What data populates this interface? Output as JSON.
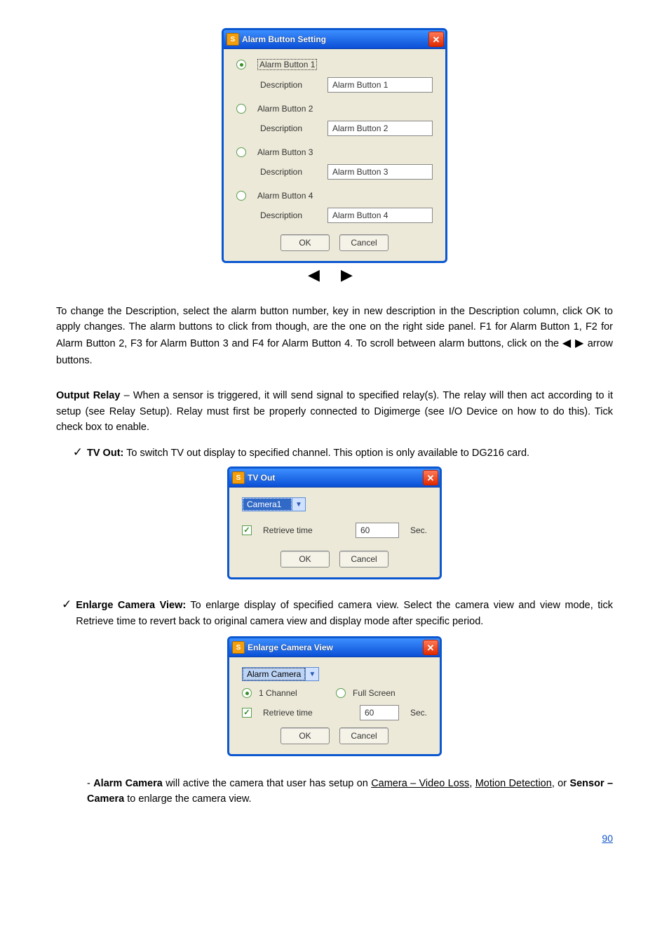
{
  "dialog1": {
    "title": "Alarm Button Setting",
    "buttons": [
      {
        "radio_label": "Alarm Button 1",
        "desc_label": "Description",
        "desc_value": "Alarm Button 1",
        "selected": true
      },
      {
        "radio_label": "Alarm Button 2",
        "desc_label": "Description",
        "desc_value": "Alarm Button 2",
        "selected": false
      },
      {
        "radio_label": "Alarm Button 3",
        "desc_label": "Description",
        "desc_value": "Alarm Button 3",
        "selected": false
      },
      {
        "radio_label": "Alarm Button 4",
        "desc_label": "Description",
        "desc_value": "Alarm Button 4",
        "selected": false
      }
    ],
    "ok": "OK",
    "cancel": "Cancel"
  },
  "para1": {
    "text": "To change the Description, select the alarm button number, key in new description in the Description column, click OK to apply changes. The alarm buttons to click from though, are the one on the right side panel. F1 for Alarm Button 1, F2 for Alarm Button 2, F3 for Alarm Button 3 and F4 for Alarm Button 4. To scroll between alarm buttons, click on the",
    "tail": " arrow buttons."
  },
  "para2": {
    "title": "Output Relay",
    "text": " – When a sensor is triggered, it will send signal to specified relay(s). The relay will then act according to it setup (see ",
    "linkish": "Relay Setup",
    "tail2": "). Relay must first be properly connected to Digimerge (see ",
    "linkish2": "I/O Device",
    "tail3": "on how to do this). Tick check box to enable."
  },
  "item_tvout": {
    "title": "TV Out:",
    "text": " To switch TV out display to specified channel. This option is only available to DG216 card."
  },
  "dialog2": {
    "title": "TV Out",
    "camera": "Camera1",
    "retrieve_label": "Retrieve time",
    "retrieve_checked": true,
    "retrieve_value": "60",
    "sec": "Sec.",
    "ok": "OK",
    "cancel": "Cancel"
  },
  "item_enlarge_intro": {
    "title": "Enlarge Camera View:",
    "text": " To enlarge display of specified camera view. Select the camera view and view mode, tick Retrieve time to revert back to original camera view and display mode after specific period."
  },
  "dialog3": {
    "title": "Enlarge Camera View",
    "camera": "Alarm Camera",
    "opt1": "1 Channel",
    "opt2": "Full Screen",
    "retrieve_label": "Retrieve time",
    "retrieve_checked": true,
    "retrieve_value": "60",
    "sec": "Sec.",
    "ok": "OK",
    "cancel": "Cancel"
  },
  "footer": {
    "text1": "- ",
    "bold1": "Alarm Camera",
    "text2": " will active the camera that user has setup on ",
    "underline": "Camera – Video Loss",
    "text3": ", ",
    "underline2": "Motion Detection",
    "text4": ", or ",
    "bold2": "Sensor – Camera",
    "text5": " to enlarge the camera view."
  },
  "pagenum": "90"
}
